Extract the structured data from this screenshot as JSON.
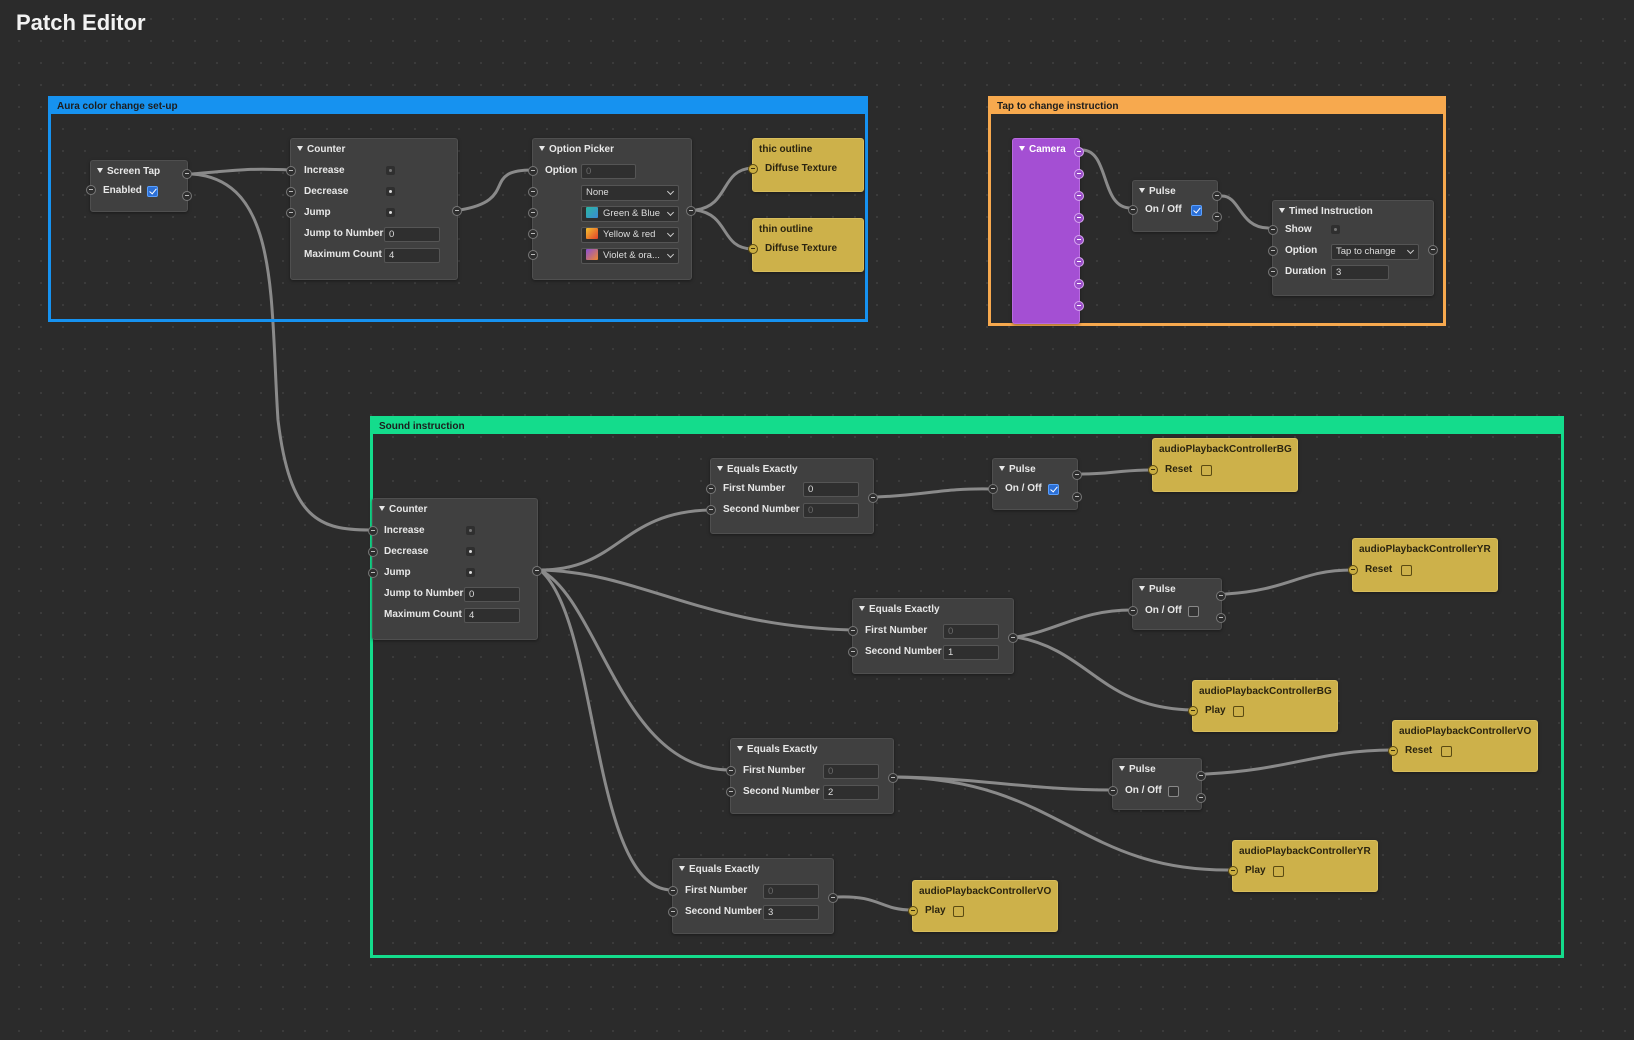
{
  "app": {
    "title": "Patch Editor"
  },
  "colors": {
    "group_blue": "#1692f0",
    "group_orange": "#f7a94e",
    "group_green": "#14dc8c",
    "camera_purple": "#a44fd3",
    "node_yellow": "#cdb14a"
  },
  "groups": {
    "aura": {
      "label": "Aura color change set-up"
    },
    "tap": {
      "label": "Tap to change instruction"
    },
    "sound": {
      "label": "Sound instruction"
    }
  },
  "aura": {
    "screen_tap": {
      "title": "Screen Tap",
      "enabled_label": "Enabled",
      "enabled": true
    },
    "counter": {
      "title": "Counter",
      "increase": "Increase",
      "decrease": "Decrease",
      "jump": "Jump",
      "jump_to_number": "Jump to Number",
      "jump_to_value": "0",
      "maximum_count": "Maximum Count",
      "maximum_value": "4"
    },
    "option_picker": {
      "title": "Option Picker",
      "option_label": "Option",
      "option_value": "0",
      "options": [
        {
          "label": "None",
          "icon": ""
        },
        {
          "label": "Green & Blue",
          "icon": "teal-swatch-icon"
        },
        {
          "label": "Yellow & red",
          "icon": "orange-swatch-icon"
        },
        {
          "label": "Violet & ora...",
          "icon": "violet-swatch-icon"
        }
      ]
    },
    "thic": {
      "title": "thic outline",
      "port_label": "Diffuse Texture"
    },
    "thin": {
      "title": "thin outline",
      "port_label": "Diffuse Texture"
    }
  },
  "tap": {
    "camera": {
      "title": "Camera"
    },
    "pulse": {
      "title": "Pulse",
      "onoff_label": "On / Off",
      "checked": true
    },
    "timed": {
      "title": "Timed Instruction",
      "show_label": "Show",
      "option_label": "Option",
      "option_value": "Tap to change",
      "duration_label": "Duration",
      "duration_value": "3"
    }
  },
  "sound": {
    "counter": {
      "title": "Counter",
      "increase": "Increase",
      "decrease": "Decrease",
      "jump": "Jump",
      "jump_to_number": "Jump to Number",
      "jump_to_value": "0",
      "maximum_count": "Maximum Count",
      "maximum_value": "4"
    },
    "eq1": {
      "title": "Equals Exactly",
      "first": "First Number",
      "first_value": "0",
      "second": "Second Number",
      "second_value": "0"
    },
    "eq2": {
      "title": "Equals Exactly",
      "first": "First Number",
      "first_value": "0",
      "second": "Second Number",
      "second_value": "1"
    },
    "eq3": {
      "title": "Equals Exactly",
      "first": "First Number",
      "first_value": "0",
      "second": "Second Number",
      "second_value": "2"
    },
    "eq4": {
      "title": "Equals Exactly",
      "first": "First Number",
      "first_value": "0",
      "second": "Second Number",
      "second_value": "3"
    },
    "pulse1": {
      "title": "Pulse",
      "onoff_label": "On / Off",
      "checked": true
    },
    "pulse2": {
      "title": "Pulse",
      "onoff_label": "On / Off",
      "checked": false
    },
    "pulse3": {
      "title": "Pulse",
      "onoff_label": "On / Off",
      "checked": false
    },
    "apc1": {
      "title": "audioPlaybackControllerBG",
      "port_label": "Reset"
    },
    "apc2": {
      "title": "audioPlaybackControllerYR",
      "port_label": "Reset"
    },
    "apc3": {
      "title": "audioPlaybackControllerBG",
      "port_label": "Play"
    },
    "apc4": {
      "title": "audioPlaybackControllerVO",
      "port_label": "Reset"
    },
    "apc5": {
      "title": "audioPlaybackControllerYR",
      "port_label": "Play"
    },
    "apc6": {
      "title": "audioPlaybackControllerVO",
      "port_label": "Play"
    }
  }
}
